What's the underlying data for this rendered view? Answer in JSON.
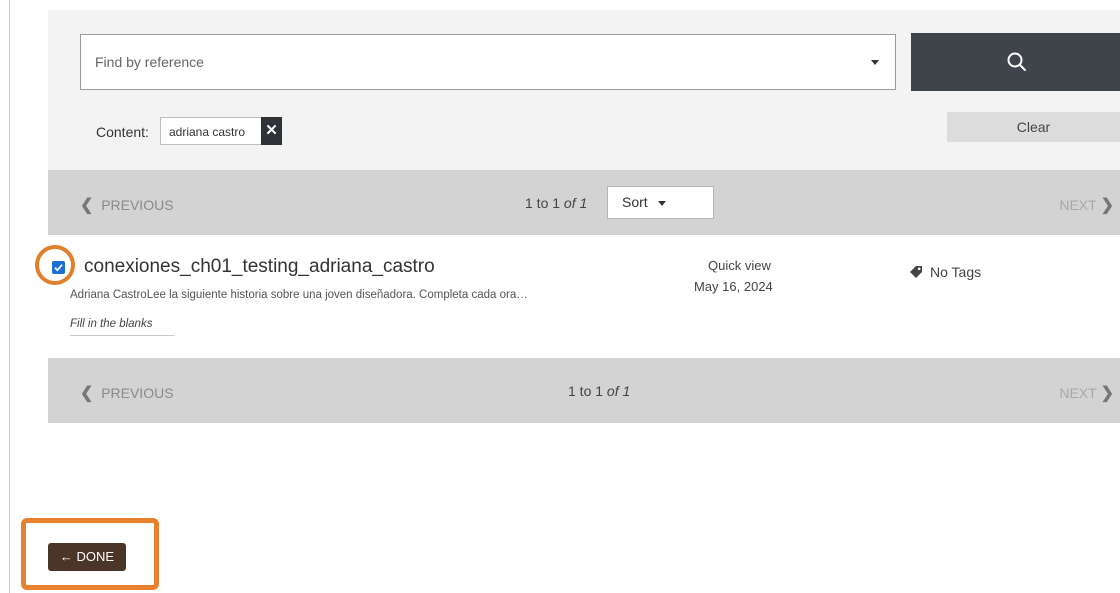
{
  "search": {
    "placeholder": "Find by reference",
    "search_button_icon": "search-icon"
  },
  "filters": {
    "content_label": "Content:",
    "chip_value": "adriana castro",
    "chip_remove_icon": "close-icon",
    "chip_remove_glyph": "✕",
    "clear_label": "Clear"
  },
  "pager": {
    "prev_glyph": "❮",
    "prev_label": "PREVIOUS",
    "next_label": "NEXT",
    "next_glyph": "❯",
    "range": "1 to 1",
    "of_label": "of 1",
    "sort_label": "Sort"
  },
  "result": {
    "checked": true,
    "title": "conexiones_ch01_testing_adriana_castro",
    "description": "Adriana CastroLee la siguiente historia sobre una joven diseñadora. Completa cada ora…",
    "type": "Fill in the blanks",
    "quick_view": "Quick view",
    "date": "May 16, 2024",
    "tags_label": "No Tags",
    "tag_icon": "tag-icon"
  },
  "done": {
    "label": "← DONE"
  },
  "colors": {
    "highlight": "#e8812e",
    "search_button": "#3e4449",
    "done_button": "#4b3528",
    "checkbox": "#1d6fd6"
  }
}
